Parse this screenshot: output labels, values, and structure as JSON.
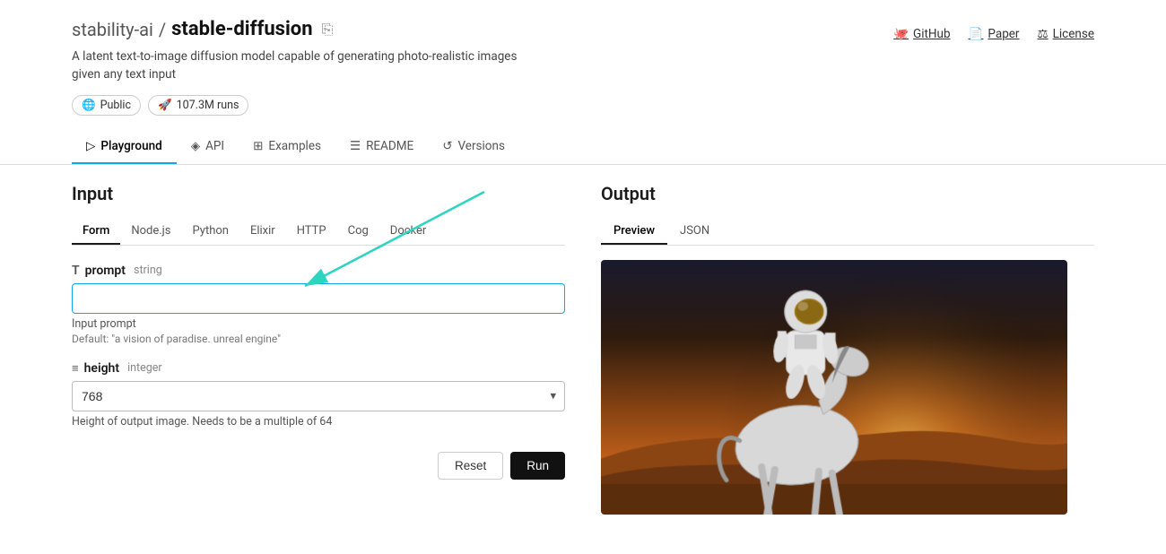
{
  "header": {
    "org": "stability-ai",
    "slash": "/",
    "repo": "stable-diffusion",
    "copy_icon": "⎘",
    "description": "A latent text-to-image diffusion model capable of generating photo-realistic images given any text input",
    "badges": [
      {
        "icon": "🌐",
        "label": "Public"
      },
      {
        "icon": "🚀",
        "label": "107.3M runs"
      }
    ],
    "links": [
      {
        "icon": "github",
        "label": "GitHub"
      },
      {
        "icon": "paper",
        "label": "Paper"
      },
      {
        "icon": "license",
        "label": "License"
      }
    ]
  },
  "nav": {
    "tabs": [
      {
        "id": "playground",
        "icon": "▷",
        "label": "Playground",
        "active": true
      },
      {
        "id": "api",
        "icon": "◈",
        "label": "API",
        "active": false
      },
      {
        "id": "examples",
        "icon": "⊞",
        "label": "Examples",
        "active": false
      },
      {
        "id": "readme",
        "icon": "☰",
        "label": "README",
        "active": false
      },
      {
        "id": "versions",
        "icon": "↺",
        "label": "Versions",
        "active": false
      }
    ]
  },
  "input": {
    "title": "Input",
    "code_tabs": [
      {
        "label": "Form",
        "active": true
      },
      {
        "label": "Node.js",
        "active": false
      },
      {
        "label": "Python",
        "active": false
      },
      {
        "label": "Elixir",
        "active": false
      },
      {
        "label": "HTTP",
        "active": false
      },
      {
        "label": "Cog",
        "active": false
      },
      {
        "label": "Docker",
        "active": false
      }
    ],
    "fields": [
      {
        "id": "prompt",
        "icon": "T",
        "name": "prompt",
        "type": "string",
        "placeholder": "",
        "hint": "Input prompt",
        "default_text": "Default: \"a vision of paradise. unreal engine\""
      },
      {
        "id": "height",
        "icon": "≡",
        "name": "height",
        "type": "integer",
        "value": "768",
        "hint": "Height of output image. Needs to be a multiple of 64"
      }
    ],
    "buttons": {
      "reset": "Reset",
      "run": "Run"
    }
  },
  "output": {
    "title": "Output",
    "tabs": [
      {
        "label": "Preview",
        "active": true
      },
      {
        "label": "JSON",
        "active": false
      }
    ]
  }
}
